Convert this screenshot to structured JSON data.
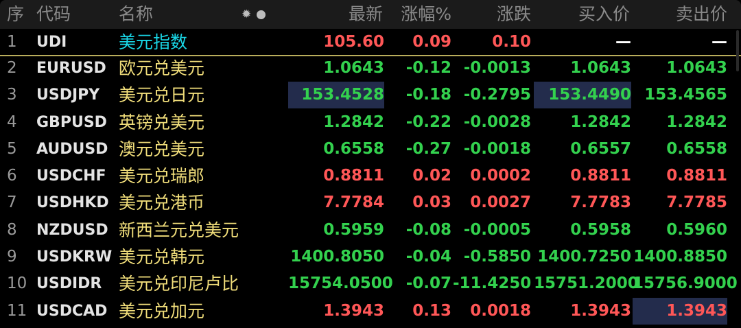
{
  "header": {
    "seq": "序",
    "code": "代码",
    "name": "名称",
    "latest": "最新",
    "change_pct": "涨幅%",
    "change": "涨跌",
    "bid": "买入价",
    "ask": "卖出价"
  },
  "colors": {
    "up": "#ff5757",
    "down": "#33d14e",
    "name": "#f0dd7a",
    "index_name": "#19d6e6",
    "highlight": "#232c4c"
  },
  "rows": [
    {
      "seq": "1",
      "code": "UDI",
      "name": "美元指数",
      "latest": "105.60",
      "pct": "0.09",
      "chg": "0.10",
      "bid": "—",
      "ask": "—",
      "trend": "up"
    },
    {
      "seq": "2",
      "code": "EURUSD",
      "name": "欧元兑美元",
      "latest": "1.0643",
      "pct": "-0.12",
      "chg": "-0.0013",
      "bid": "1.0643",
      "ask": "1.0643",
      "trend": "down"
    },
    {
      "seq": "3",
      "code": "USDJPY",
      "name": "美元兑日元",
      "latest": "153.4528",
      "pct": "-0.18",
      "chg": "-0.2795",
      "bid": "153.4490",
      "ask": "153.4565",
      "trend": "down"
    },
    {
      "seq": "4",
      "code": "GBPUSD",
      "name": "英镑兑美元",
      "latest": "1.2842",
      "pct": "-0.22",
      "chg": "-0.0028",
      "bid": "1.2842",
      "ask": "1.2842",
      "trend": "down"
    },
    {
      "seq": "5",
      "code": "AUDUSD",
      "name": "澳元兑美元",
      "latest": "0.6558",
      "pct": "-0.27",
      "chg": "-0.0018",
      "bid": "0.6557",
      "ask": "0.6558",
      "trend": "down"
    },
    {
      "seq": "6",
      "code": "USDCHF",
      "name": "美元兑瑞郎",
      "latest": "0.8811",
      "pct": "0.02",
      "chg": "0.0002",
      "bid": "0.8811",
      "ask": "0.8811",
      "trend": "up"
    },
    {
      "seq": "7",
      "code": "USDHKD",
      "name": "美元兑港币",
      "latest": "7.7784",
      "pct": "0.03",
      "chg": "0.0027",
      "bid": "7.7783",
      "ask": "7.7785",
      "trend": "up"
    },
    {
      "seq": "8",
      "code": "NZDUSD",
      "name": "新西兰元兑美元",
      "latest": "0.5959",
      "pct": "-0.08",
      "chg": "-0.0005",
      "bid": "0.5958",
      "ask": "0.5960",
      "trend": "down"
    },
    {
      "seq": "9",
      "code": "USDKRW",
      "name": "美元兑韩元",
      "latest": "1400.8050",
      "pct": "-0.04",
      "chg": "-0.5850",
      "bid": "1400.7250",
      "ask": "1400.8850",
      "trend": "down"
    },
    {
      "seq": "10",
      "code": "USDIDR",
      "name": "美元兑印尼卢比",
      "latest": "15754.0500",
      "pct": "-0.07",
      "chg": "-11.4250",
      "bid": "15751.2000",
      "ask": "15756.9000",
      "trend": "down"
    },
    {
      "seq": "11",
      "code": "USDCAD",
      "name": "美元兑加元",
      "latest": "1.3943",
      "pct": "0.13",
      "chg": "0.0018",
      "bid": "1.3943",
      "ask": "1.3943",
      "trend": "up"
    }
  ]
}
